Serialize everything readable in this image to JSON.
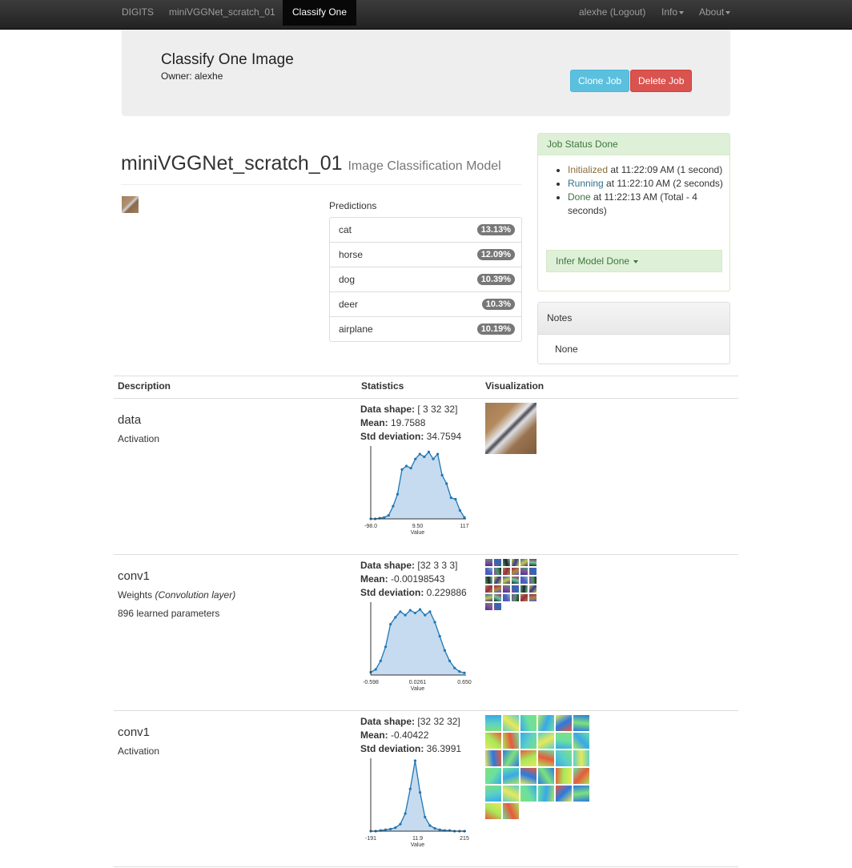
{
  "navbar": {
    "brand": "DIGITS",
    "model_link": "miniVGGNet_scratch_01",
    "active": "Classify One",
    "user": "alexhe (Logout)",
    "info": "Info",
    "about": "About"
  },
  "header": {
    "title": "Classify One Image",
    "owner": "Owner: alexhe",
    "clone_label": "Clone Job",
    "delete_label": "Delete Job"
  },
  "model": {
    "name": "miniVGGNet_scratch_01",
    "type": "Image Classification Model"
  },
  "predictions": {
    "label": "Predictions",
    "items": [
      {
        "label": "cat",
        "value": "13.13%"
      },
      {
        "label": "horse",
        "value": "12.09%"
      },
      {
        "label": "dog",
        "value": "10.39%"
      },
      {
        "label": "deer",
        "value": "10.3%"
      },
      {
        "label": "airplane",
        "value": "10.19%"
      }
    ]
  },
  "job_status": {
    "title": "Job Status Done",
    "items": [
      {
        "state": "Initialized",
        "text": " at 11:22:09 AM (1 second)"
      },
      {
        "state": "Running",
        "text": " at 11:22:10 AM (2 seconds)"
      },
      {
        "state": "Done",
        "text": " at 11:22:13 AM (Total - 4 seconds)"
      }
    ],
    "infer_label": "Infer Model Done"
  },
  "notes": {
    "title": "Notes",
    "body": "None"
  },
  "table": {
    "headers": [
      "Description",
      "Statistics",
      "Visualization"
    ],
    "shape_label": "Data shape:",
    "mean_label": "Mean:",
    "std_label": "Std deviation:",
    "axis_label": "Value",
    "rows": [
      {
        "name": "data",
        "kind": "Activation",
        "kind_extra": "",
        "params": "",
        "shape": " [ 3 32 32]",
        "mean": " 19.7588",
        "std": " 34.7594",
        "ticks": [
          "-98.0",
          "9.50",
          "117"
        ]
      },
      {
        "name": "conv1",
        "kind": "Weights",
        "kind_extra": "(Convolution layer)",
        "params": "896 learned parameters",
        "shape": " [32 3 3 3]",
        "mean": " -0.00198543",
        "std": " 0.229886",
        "ticks": [
          "-0.598",
          "0.0261",
          "0.650"
        ]
      },
      {
        "name": "conv1",
        "kind": "Activation",
        "kind_extra": "",
        "params": "",
        "shape": " [32 32 32]",
        "mean": " -0.40422",
        "std": " 36.3991",
        "ticks": [
          "-191",
          "11.9",
          "215"
        ]
      }
    ]
  },
  "histograms": [
    [
      0.0,
      0.0,
      0.01,
      0.02,
      0.05,
      0.18,
      0.35,
      0.7,
      0.75,
      0.72,
      0.85,
      0.92,
      0.88,
      0.95,
      0.85,
      0.92,
      0.62,
      0.5,
      0.3,
      0.28,
      0.12,
      0.02
    ],
    [
      0.04,
      0.08,
      0.2,
      0.4,
      0.72,
      0.82,
      0.9,
      0.85,
      0.92,
      0.88,
      0.93,
      0.85,
      0.9,
      0.75,
      0.55,
      0.35,
      0.2,
      0.1,
      0.05,
      0.03
    ],
    [
      0.0,
      0.0,
      0.01,
      0.02,
      0.03,
      0.05,
      0.1,
      0.25,
      0.6,
      1.0,
      0.55,
      0.2,
      0.08,
      0.04,
      0.02,
      0.01,
      0.01,
      0.0,
      0.0,
      0.0
    ]
  ],
  "colors": {
    "hist_line": "#1f77b4",
    "hist_fill": "#c6dbef"
  }
}
